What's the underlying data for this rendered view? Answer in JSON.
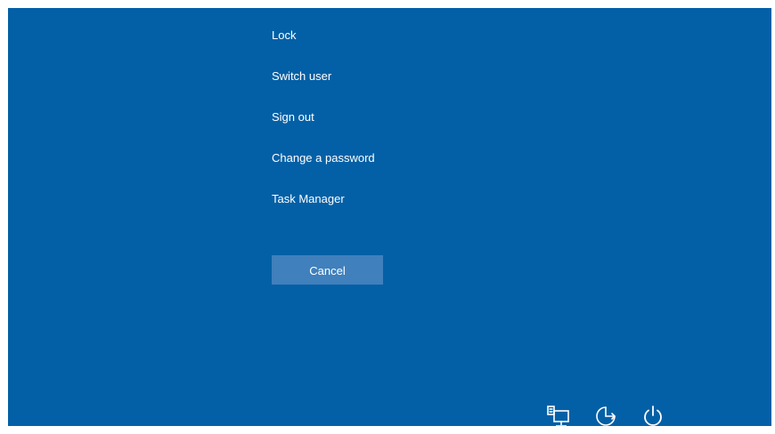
{
  "menu": {
    "items": [
      {
        "label": "Lock"
      },
      {
        "label": "Switch user"
      },
      {
        "label": "Sign out"
      },
      {
        "label": "Change a password"
      },
      {
        "label": "Task Manager"
      }
    ]
  },
  "cancel": {
    "label": "Cancel"
  },
  "tray": {
    "icons": [
      {
        "icon": "network-icon"
      },
      {
        "icon": "ease-of-access-icon"
      },
      {
        "icon": "power-icon"
      }
    ]
  },
  "colors": {
    "background": "#0460a6",
    "button": "#4080bc",
    "text": "#ffffff"
  }
}
